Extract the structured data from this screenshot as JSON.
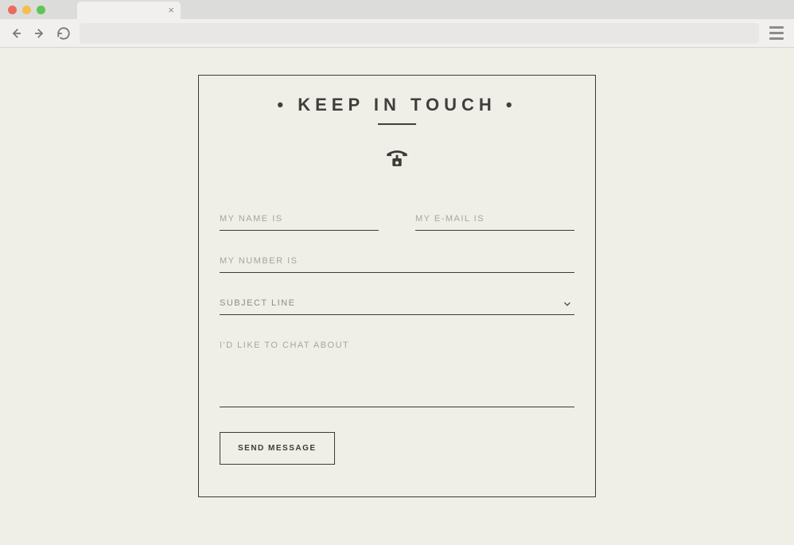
{
  "browser": {
    "address_value": ""
  },
  "form": {
    "heading": "•  KEEP IN TOUCH  •",
    "name_placeholder": "MY NAME IS",
    "email_placeholder": "MY E-MAIL IS",
    "phone_placeholder": "MY NUMBER IS",
    "subject_placeholder": "SUBJECT LINE",
    "message_placeholder": "I'D LIKE TO CHAT ABOUT",
    "submit_label": "SEND MESSAGE"
  }
}
